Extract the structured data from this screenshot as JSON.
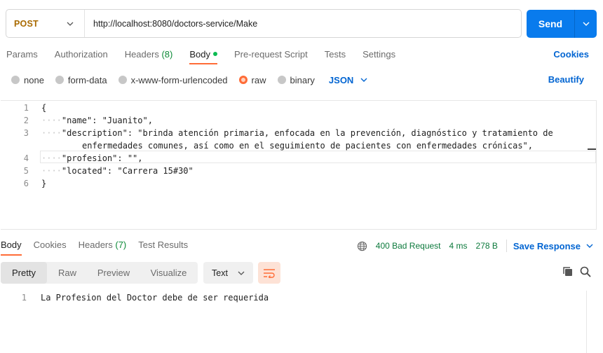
{
  "request": {
    "method": "POST",
    "url": "http://localhost:8080/doctors-service/Make",
    "send_label": "Send"
  },
  "request_tabs": [
    {
      "label": "Params"
    },
    {
      "label": "Authorization"
    },
    {
      "label": "Headers",
      "count": "(8)"
    },
    {
      "label": "Body",
      "active": true
    },
    {
      "label": "Pre-request Script"
    },
    {
      "label": "Tests"
    },
    {
      "label": "Settings"
    }
  ],
  "cookies_label": "Cookies",
  "body_types": [
    {
      "label": "none"
    },
    {
      "label": "form-data"
    },
    {
      "label": "x-www-form-urlencoded"
    },
    {
      "label": "raw",
      "selected": true
    },
    {
      "label": "binary"
    }
  ],
  "language": "JSON",
  "beautify_label": "Beautify",
  "editor": {
    "line_numbers": [
      "1",
      "2",
      "3",
      "",
      "4",
      "5",
      "6"
    ],
    "lines": [
      "{",
      "\"name\": \"Juanito\",",
      "\"description\": \"brinda atención primaria, enfocada en la prevención, diagnóstico y tratamiento de",
      "enfermedades comunes, así como en el seguimiento de pacientes con enfermedades crónicas\",",
      "\"profesion\": \"\",",
      "\"located\": \"Carrera 15#30\"",
      "}"
    ]
  },
  "response_tabs": [
    {
      "label": "Body",
      "active": true
    },
    {
      "label": "Cookies"
    },
    {
      "label": "Headers",
      "count": "(7)"
    },
    {
      "label": "Test Results"
    }
  ],
  "response_meta": {
    "status": "400 Bad Request",
    "time": "4 ms",
    "size": "278 B",
    "save_label": "Save Response"
  },
  "view_modes": [
    "Pretty",
    "Raw",
    "Preview",
    "Visualize"
  ],
  "format": "Text",
  "response_body": {
    "line_number": "1",
    "text": "La Profesion del Doctor debe de ser requerida"
  },
  "colors": {
    "accent": "#ff6c37",
    "send_button": "#097bed",
    "method": "#a96a00",
    "link": "#0265d2",
    "status_ok_text": "#0c7a3c"
  }
}
